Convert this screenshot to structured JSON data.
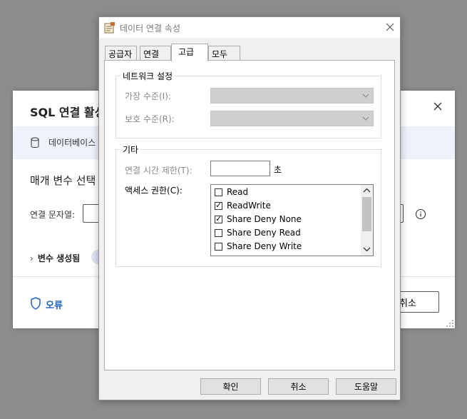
{
  "background_dialog": {
    "title": "SQL 연결 활성",
    "banner_text": "데이터베이스",
    "heading": "매개 변수 선택",
    "connection_label": "연결 문자열:",
    "variables_label": "변수 생성됨",
    "error_label": "오류",
    "cancel_label": "취소"
  },
  "dialog": {
    "title": "데이터 연결 속성",
    "tabs": [
      {
        "label": "공급자"
      },
      {
        "label": "연결"
      },
      {
        "label": "고급"
      },
      {
        "label": "모두"
      }
    ],
    "active_tab": "고급",
    "network_group": {
      "title": "네트워크 설정",
      "impersonation_label": "가장 수준(I):",
      "protection_label": "보호 수준(R):"
    },
    "other_group": {
      "title": "기타",
      "timeout_label": "연결 시간 제한(T):",
      "timeout_value": "",
      "timeout_unit": "초",
      "access_label": "액세스 권한(C):",
      "access_items": [
        {
          "label": "Read",
          "checked": false
        },
        {
          "label": "ReadWrite",
          "checked": true
        },
        {
          "label": "Share Deny None",
          "checked": true
        },
        {
          "label": "Share Deny Read",
          "checked": false
        },
        {
          "label": "Share Deny Write",
          "checked": false
        }
      ]
    },
    "buttons": {
      "ok": "확인",
      "cancel": "취소",
      "help": "도움말"
    }
  }
}
